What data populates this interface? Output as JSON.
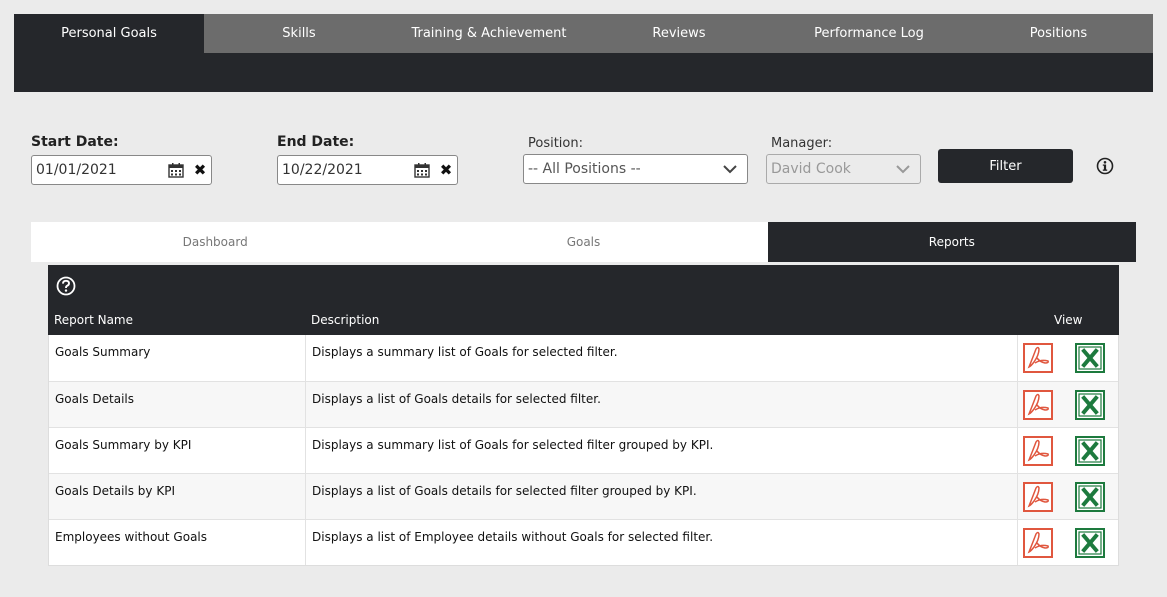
{
  "nav": {
    "tabs": [
      {
        "label": "Personal Goals",
        "active": true
      },
      {
        "label": "Skills"
      },
      {
        "label": "Training & Achievement"
      },
      {
        "label": "Reviews"
      },
      {
        "label": "Performance Log"
      },
      {
        "label": "Positions"
      }
    ]
  },
  "filters": {
    "start_date_label": "Start Date:",
    "start_date_value": "01/01/2021",
    "end_date_label": "End Date:",
    "end_date_value": "10/22/2021",
    "position_label": "Position:",
    "position_value": "-- All Positions --",
    "manager_label": "Manager:",
    "manager_value": "David Cook",
    "filter_button": "Filter",
    "clear_glyph": "✖"
  },
  "subtabs": [
    {
      "label": "Dashboard"
    },
    {
      "label": "Goals"
    },
    {
      "label": "Reports",
      "active": true
    }
  ],
  "reports": {
    "columns": {
      "name": "Report Name",
      "description": "Description",
      "view": "View"
    },
    "rows": [
      {
        "name": "Goals Summary",
        "description": "Displays a summary list of Goals for selected filter."
      },
      {
        "name": "Goals Details",
        "description": "Displays a list of Goals details for selected filter."
      },
      {
        "name": "Goals Summary by KPI",
        "description": "Displays a summary list of Goals for selected filter grouped by KPI."
      },
      {
        "name": "Goals Details by KPI",
        "description": "Displays a list of Goals details for selected filter grouped by KPI."
      },
      {
        "name": "Employees without Goals",
        "description": "Displays a list of Employee details without Goals for selected filter."
      }
    ]
  },
  "icons": {
    "calendar": "calendar-icon",
    "clear": "clear-x-icon",
    "chevron": "chevron-down-icon",
    "info": "info-icon",
    "help": "help-circle-icon",
    "pdf": "pdf-download-icon",
    "excel": "excel-download-icon"
  },
  "colors": {
    "dark": "#25272b",
    "nav_inactive": "#6c6c6c",
    "pdf": "#e0573f",
    "excel": "#1d7a3e",
    "background": "#ebebeb"
  }
}
